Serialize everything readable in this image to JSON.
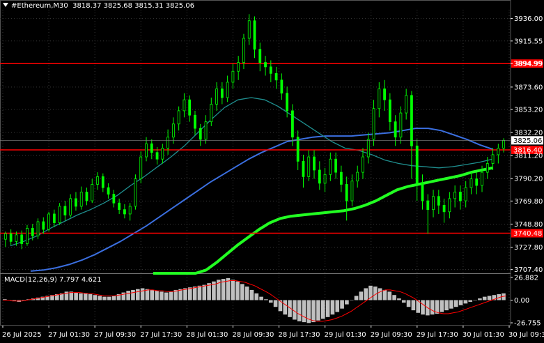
{
  "header": {
    "symbol_timeframe": "#Ethereum,M30",
    "ohlc": "3818.37 3825.68 3815.31 3825.06"
  },
  "colors": {
    "background": "#000000",
    "grid": "#3a3a3a",
    "candle": "#00ff00",
    "ma_fast": "#3b6fe0",
    "ma_mid": "#1f8f8f",
    "ma_slow": "#22ff22",
    "level_line": "#ff0000",
    "macd_hist": "#c0c0c0",
    "macd_signal": "#ff0000",
    "price_box": "#000000",
    "level_box": "#ff0000"
  },
  "price_axis": {
    "ticks": [
      "3936.00",
      "3915.55",
      "3894.99",
      "3873.60",
      "3853.20",
      "3832.20",
      "3811.20",
      "3790.20",
      "3769.80",
      "3748.80",
      "3727.80",
      "3707.40"
    ],
    "current_price": "3825.06"
  },
  "levels": [
    {
      "value": 3894.99,
      "label": "3894.99"
    },
    {
      "value": 3816.4,
      "label": "3816.40"
    },
    {
      "value": 3740.48,
      "label": "3740.48"
    }
  ],
  "time_axis": {
    "labels": [
      "26 Jul 2025",
      "27 Jul 01:30",
      "27 Jul 09:30",
      "27 Jul 17:30",
      "28 Jul 01:30",
      "28 Jul 09:30",
      "28 Jul 17:30",
      "29 Jul 01:30",
      "29 Jul 09:30",
      "29 Jul 17:30",
      "30 Jul 01:30",
      "30 Jul 09:30"
    ]
  },
  "macd": {
    "label": "MACD(12,26,9) 7.797 4.621",
    "ticks": [
      "26.882",
      "0.00",
      "-26.755"
    ]
  },
  "chart_data": {
    "type": "candlestick",
    "ylim": [
      3704,
      3944
    ],
    "candles": [
      [
        3735,
        3740,
        3728,
        3742
      ],
      [
        3740,
        3733,
        3730,
        3744
      ],
      [
        3733,
        3739,
        3729,
        3742
      ],
      [
        3739,
        3731,
        3726,
        3743
      ],
      [
        3731,
        3745,
        3729,
        3748
      ],
      [
        3745,
        3738,
        3734,
        3749
      ],
      [
        3738,
        3751,
        3735,
        3754
      ],
      [
        3751,
        3744,
        3740,
        3755
      ],
      [
        3744,
        3758,
        3742,
        3760
      ],
      [
        3758,
        3750,
        3746,
        3762
      ],
      [
        3750,
        3765,
        3748,
        3768
      ],
      [
        3765,
        3757,
        3752,
        3770
      ],
      [
        3757,
        3772,
        3755,
        3776
      ],
      [
        3772,
        3765,
        3761,
        3778
      ],
      [
        3765,
        3778,
        3762,
        3783
      ],
      [
        3778,
        3770,
        3766,
        3782
      ],
      [
        3770,
        3785,
        3768,
        3790
      ],
      [
        3785,
        3792,
        3780,
        3796
      ],
      [
        3792,
        3782,
        3778,
        3795
      ],
      [
        3782,
        3776,
        3772,
        3786
      ],
      [
        3776,
        3768,
        3764,
        3780
      ],
      [
        3768,
        3762,
        3758,
        3772
      ],
      [
        3762,
        3758,
        3754,
        3767
      ],
      [
        3758,
        3765,
        3752,
        3768
      ],
      [
        3765,
        3790,
        3762,
        3794
      ],
      [
        3790,
        3810,
        3786,
        3815
      ],
      [
        3810,
        3822,
        3806,
        3828
      ],
      [
        3822,
        3814,
        3808,
        3826
      ],
      [
        3814,
        3808,
        3803,
        3819
      ],
      [
        3808,
        3818,
        3804,
        3822
      ],
      [
        3818,
        3828,
        3812,
        3835
      ],
      [
        3828,
        3840,
        3822,
        3846
      ],
      [
        3840,
        3852,
        3834,
        3856
      ],
      [
        3852,
        3862,
        3846,
        3868
      ],
      [
        3862,
        3848,
        3842,
        3866
      ],
      [
        3848,
        3836,
        3830,
        3852
      ],
      [
        3836,
        3826,
        3820,
        3840
      ],
      [
        3826,
        3842,
        3822,
        3848
      ],
      [
        3842,
        3858,
        3838,
        3864
      ],
      [
        3858,
        3872,
        3852,
        3878
      ],
      [
        3872,
        3864,
        3858,
        3878
      ],
      [
        3864,
        3878,
        3860,
        3884
      ],
      [
        3878,
        3888,
        3872,
        3895
      ],
      [
        3888,
        3896,
        3880,
        3902
      ],
      [
        3896,
        3918,
        3890,
        3922
      ],
      [
        3918,
        3934,
        3912,
        3940
      ],
      [
        3934,
        3908,
        3900,
        3938
      ],
      [
        3908,
        3896,
        3888,
        3914
      ],
      [
        3896,
        3892,
        3884,
        3902
      ],
      [
        3892,
        3886,
        3878,
        3898
      ],
      [
        3886,
        3880,
        3872,
        3892
      ],
      [
        3880,
        3868,
        3862,
        3886
      ],
      [
        3868,
        3852,
        3846,
        3874
      ],
      [
        3852,
        3828,
        3820,
        3858
      ],
      [
        3828,
        3806,
        3798,
        3834
      ],
      [
        3806,
        3792,
        3782,
        3812
      ],
      [
        3792,
        3810,
        3788,
        3816
      ],
      [
        3810,
        3798,
        3790,
        3816
      ],
      [
        3798,
        3786,
        3780,
        3806
      ],
      [
        3786,
        3794,
        3778,
        3800
      ],
      [
        3794,
        3808,
        3788,
        3814
      ],
      [
        3808,
        3796,
        3790,
        3814
      ],
      [
        3796,
        3785,
        3778,
        3802
      ],
      [
        3785,
        3770,
        3752,
        3792
      ],
      [
        3770,
        3788,
        3765,
        3794
      ],
      [
        3788,
        3796,
        3782,
        3802
      ],
      [
        3796,
        3810,
        3790,
        3818
      ],
      [
        3810,
        3826,
        3804,
        3832
      ],
      [
        3826,
        3854,
        3820,
        3862
      ],
      [
        3854,
        3872,
        3846,
        3878
      ],
      [
        3872,
        3862,
        3852,
        3880
      ],
      [
        3862,
        3842,
        3834,
        3868
      ],
      [
        3842,
        3828,
        3820,
        3848
      ],
      [
        3828,
        3850,
        3822,
        3856
      ],
      [
        3850,
        3866,
        3844,
        3872
      ],
      [
        3866,
        3820,
        3790,
        3870
      ],
      [
        3820,
        3786,
        3770,
        3826
      ],
      [
        3786,
        3770,
        3762,
        3794
      ],
      [
        3770,
        3762,
        3740,
        3776
      ],
      [
        3762,
        3774,
        3755,
        3780
      ],
      [
        3774,
        3766,
        3758,
        3780
      ],
      [
        3766,
        3760,
        3750,
        3772
      ],
      [
        3760,
        3772,
        3754,
        3778
      ],
      [
        3772,
        3778,
        3764,
        3784
      ],
      [
        3778,
        3770,
        3762,
        3784
      ],
      [
        3770,
        3782,
        3764,
        3788
      ],
      [
        3782,
        3790,
        3776,
        3796
      ],
      [
        3790,
        3784,
        3776,
        3796
      ],
      [
        3784,
        3796,
        3778,
        3802
      ],
      [
        3796,
        3804,
        3790,
        3810
      ],
      [
        3804,
        3812,
        3798,
        3818
      ],
      [
        3812,
        3818,
        3804,
        3822
      ],
      [
        3818,
        3825,
        3814,
        3827
      ]
    ],
    "series": [
      {
        "values": [
          3706,
          3707,
          3709,
          3712,
          3716,
          3721,
          3727,
          3733,
          3740,
          3747,
          3755,
          3763,
          3771,
          3779,
          3787,
          3794,
          3801,
          3808,
          3814,
          3819,
          3824,
          3826,
          3828,
          3829,
          3829,
          3829,
          3830,
          3831,
          3832,
          3834,
          3836,
          3836,
          3834,
          3830,
          3826,
          3821,
          3817
        ]
      },
      {
        "values": [
          3729,
          3733,
          3738,
          3745,
          3751,
          3757,
          3762,
          3768,
          3775,
          3784,
          3792,
          3801,
          3810,
          3820,
          3832,
          3844,
          3855,
          3862,
          3864,
          3862,
          3856,
          3848,
          3840,
          3832,
          3824,
          3818,
          3816,
          3812,
          3807,
          3804,
          3802,
          3801,
          3800,
          3801,
          3803,
          3805,
          3808
        ]
      },
      {
        "values": [
          3680,
          3684,
          3689,
          3694,
          3700,
          3707,
          3714,
          3722,
          3730,
          3737,
          3744,
          3750,
          3754,
          3756,
          3757,
          3758,
          3759,
          3760,
          3761,
          3763,
          3766,
          3770,
          3775,
          3780,
          3783,
          3785,
          3787,
          3789,
          3791,
          3793,
          3796,
          3798,
          3800
        ]
      }
    ],
    "macd": {
      "ylim": [
        -30,
        30
      ],
      "hist": [
        1,
        0,
        -1,
        -2,
        -1,
        1,
        2,
        3,
        4,
        5,
        6,
        7,
        8,
        10,
        10,
        9,
        8,
        8,
        7,
        6,
        5,
        4,
        4,
        5,
        7,
        9,
        11,
        12,
        13,
        14,
        13,
        12,
        11,
        10,
        9,
        10,
        12,
        13,
        14,
        15,
        16,
        17,
        18,
        20,
        22,
        24,
        25,
        26,
        24,
        22,
        19,
        16,
        12,
        8,
        4,
        1,
        -3,
        -8,
        -13,
        -17,
        -20,
        -23,
        -25,
        -26,
        -27,
        -26,
        -24,
        -22,
        -20,
        -17,
        -14,
        -10,
        -5,
        0,
        5,
        10,
        14,
        17,
        16,
        14,
        12,
        10,
        6,
        2,
        -3,
        -8,
        -12,
        -15,
        -17,
        -18,
        -17,
        -16,
        -14,
        -12,
        -10,
        -8,
        -6,
        -4,
        -2,
        0,
        2,
        4,
        5,
        6,
        7,
        8
      ],
      "signal": [
        0,
        0,
        -1,
        -1,
        -1,
        0,
        1,
        2,
        3,
        4,
        5,
        6,
        7,
        8,
        9,
        9,
        9,
        8,
        8,
        7,
        6,
        5,
        5,
        5,
        6,
        7,
        8,
        9,
        10,
        11,
        12,
        12,
        11,
        11,
        10,
        10,
        11,
        12,
        13,
        14,
        15,
        16,
        17,
        18,
        19,
        21,
        22,
        23,
        23,
        22,
        21,
        19,
        17,
        14,
        11,
        8,
        4,
        0,
        -4,
        -8,
        -12,
        -16,
        -19,
        -22,
        -24,
        -25,
        -25,
        -24,
        -23,
        -21,
        -19,
        -16,
        -13,
        -9,
        -5,
        -1,
        3,
        7,
        10,
        12,
        12,
        11,
        10,
        8,
        5,
        2,
        -2,
        -6,
        -10,
        -13,
        -15,
        -16,
        -16,
        -15,
        -14,
        -12,
        -10,
        -8,
        -6,
        -4,
        -2,
        0,
        2,
        4,
        5
      ]
    }
  }
}
